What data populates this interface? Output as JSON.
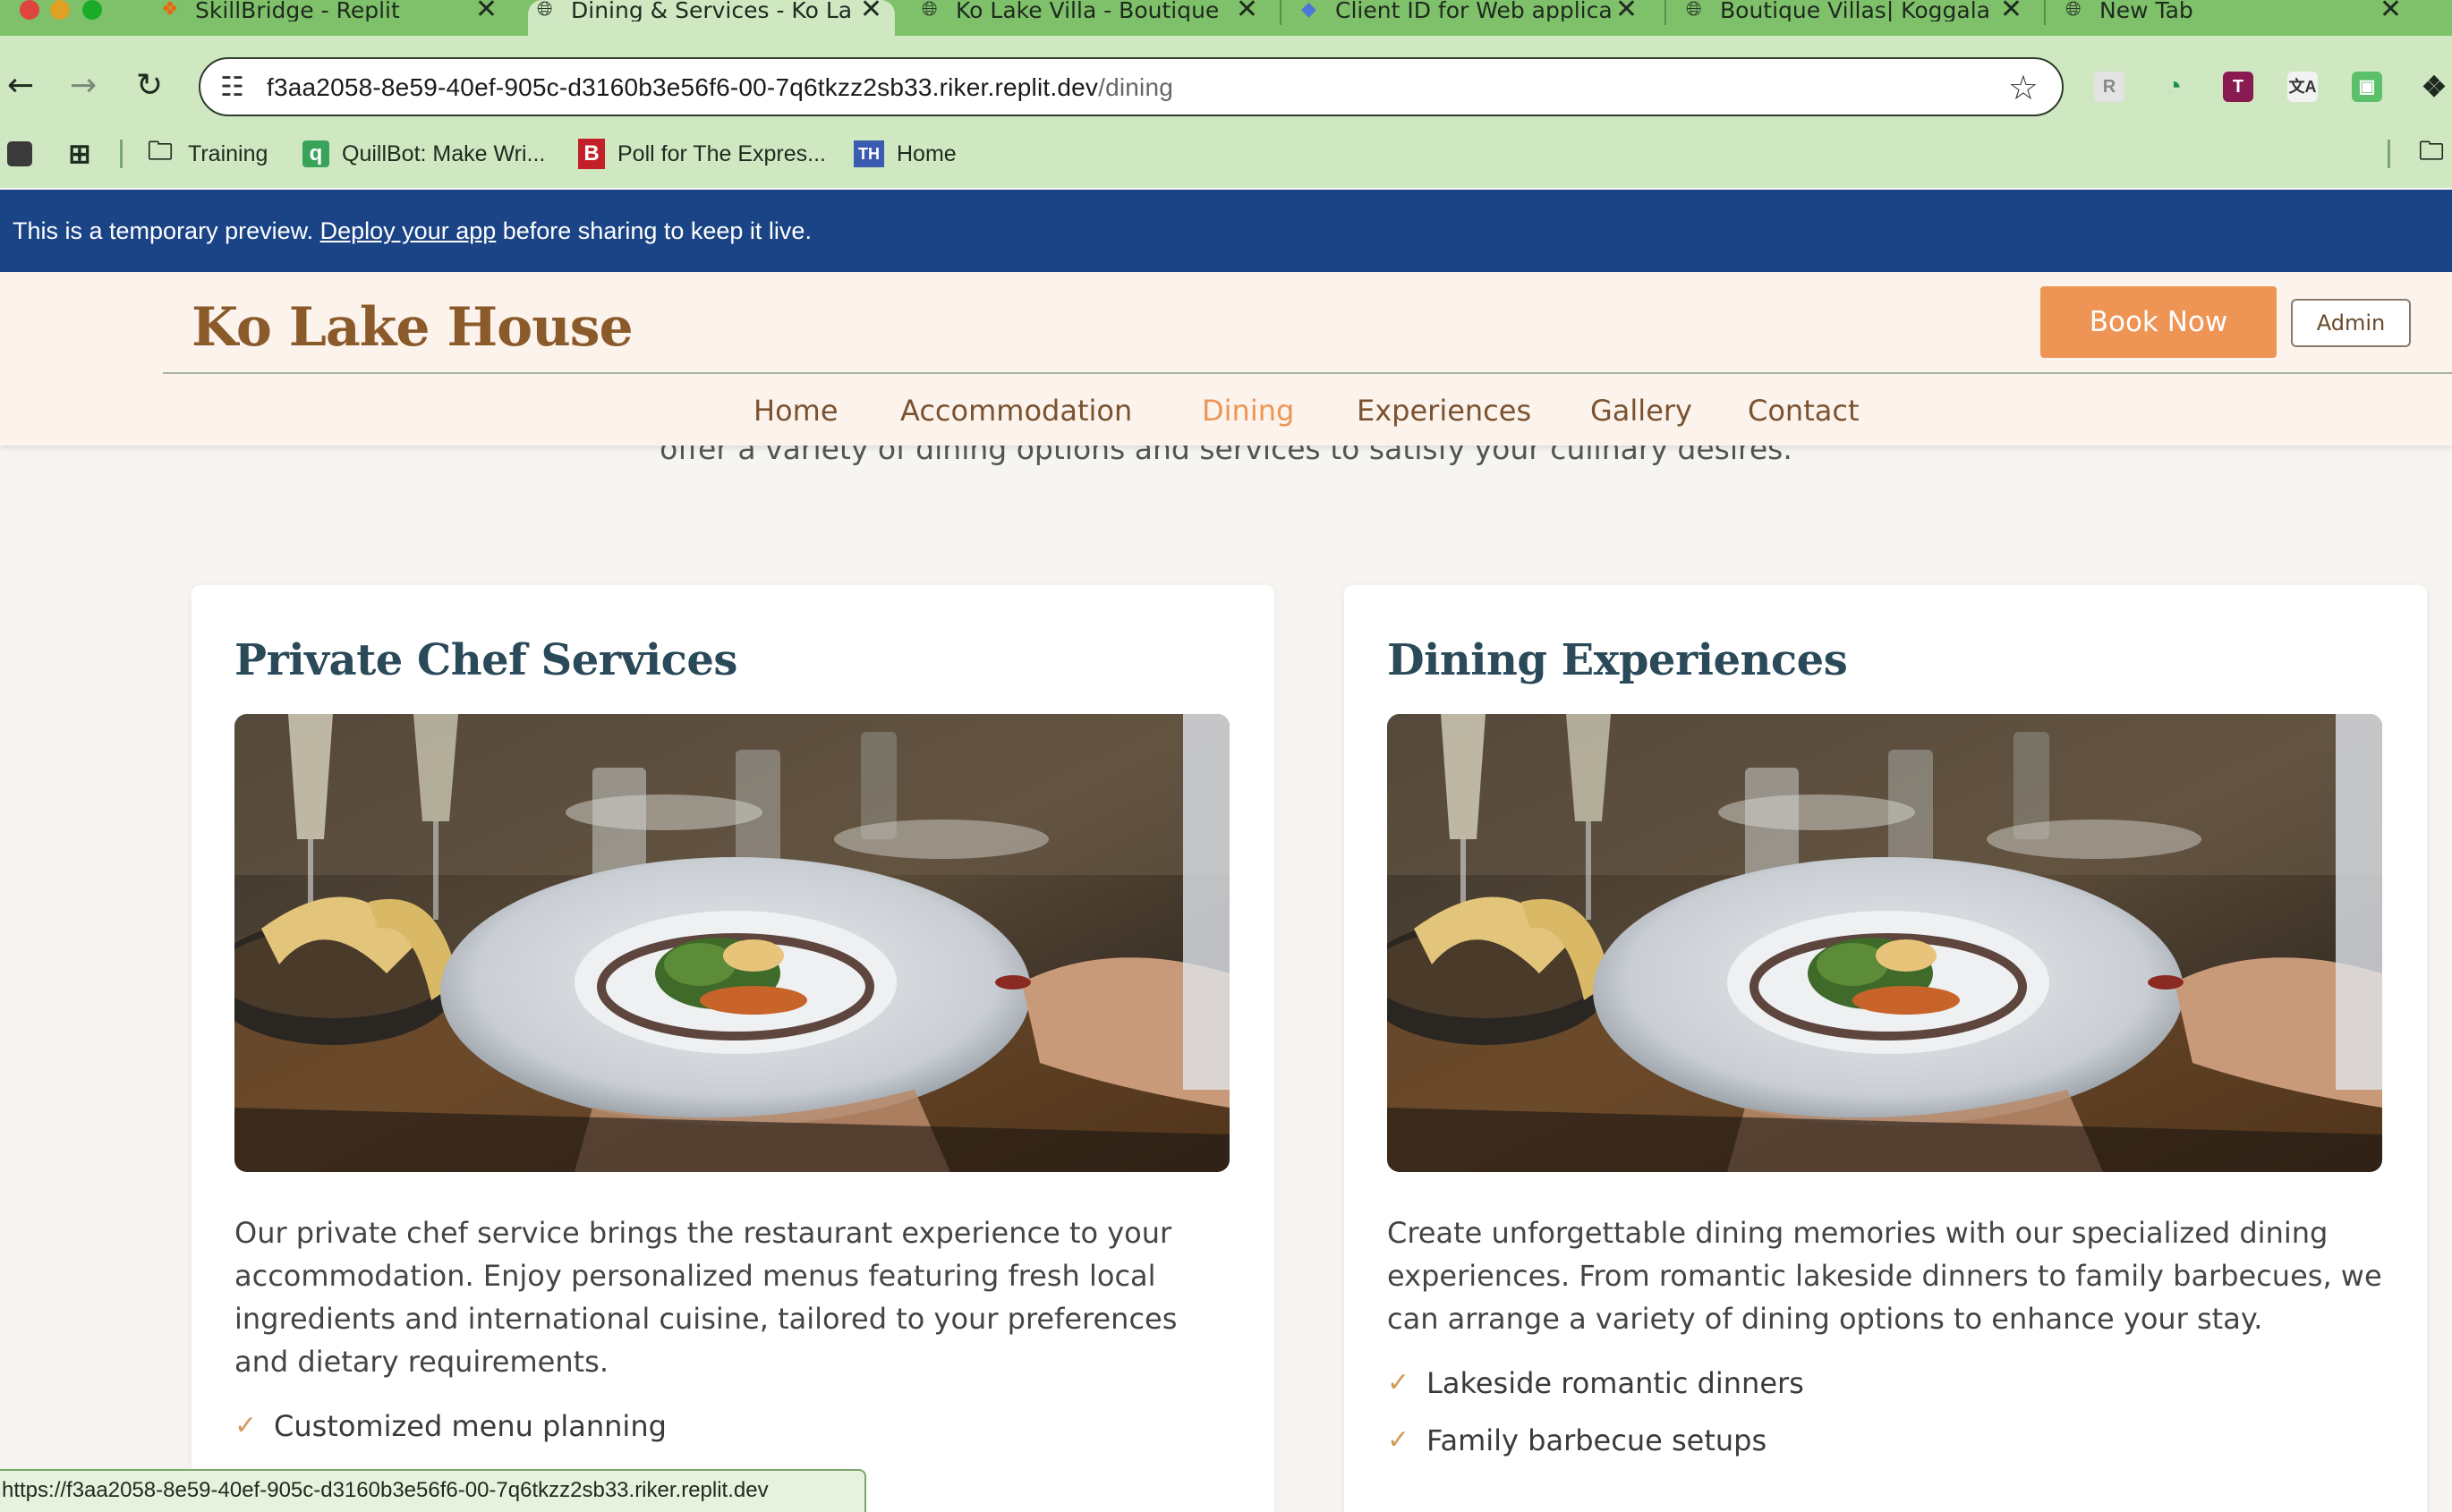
{
  "browser": {
    "tabs": [
      {
        "title": "SkillBridge - Replit",
        "icon": "replit-icon"
      },
      {
        "title": "Dining & Services - Ko La",
        "icon": "globe-icon"
      },
      {
        "title": "Ko Lake Villa - Boutique",
        "icon": "globe-icon"
      },
      {
        "title": "Client ID for Web applica",
        "icon": "google-cloud-icon"
      },
      {
        "title": "Boutique Villas| Koggala",
        "icon": "globe-icon"
      },
      {
        "title": "New Tab",
        "icon": "globe-icon"
      }
    ],
    "address": {
      "host": "f3aa2058-8e59-40ef-905c-d3160b3e56f6-00-7q6tkzz2sb33.riker.replit.dev",
      "path": "/dining"
    },
    "bookmarks": [
      {
        "label": "Training",
        "icon": "folder-icon"
      },
      {
        "label": "QuillBot: Make Wri...",
        "icon": "quillbot-icon"
      },
      {
        "label": "Poll for The Expres...",
        "icon": "poll-icon"
      },
      {
        "label": "Home",
        "icon": "th-icon"
      }
    ],
    "status_url": "https://f3aa2058-8e59-40ef-905c-d3160b3e56f6-00-7q6tkzz2sb33.riker.replit.dev"
  },
  "banner": {
    "before": "This is a temporary preview. ",
    "link": "Deploy your app",
    "after": " before sharing to keep it live."
  },
  "site": {
    "brand": "Ko Lake House",
    "book_label": "Book Now",
    "admin_label": "Admin",
    "nav": [
      "Home",
      "Accommodation",
      "Dining",
      "Experiences",
      "Gallery",
      "Contact"
    ],
    "active_nav": "Dining",
    "intro_tail": "offer a variety of dining options and services to satisfy your culinary desires."
  },
  "cards": [
    {
      "title": "Private Chef Services",
      "description": "Our private chef service brings the restaurant experience to your accommodation. Enjoy personalized menus featuring fresh local ingredients and international cuisine, tailored to your preferences and dietary requirements.",
      "features": [
        "Customized menu planning"
      ]
    },
    {
      "title": "Dining Experiences",
      "description": "Create unforgettable dining memories with our specialized dining experiences. From romantic lakeside dinners to family barbecues, we can arrange a variety of dining options to enhance your stay.",
      "features": [
        "Lakeside romantic dinners",
        "Family barbecue setups"
      ]
    }
  ],
  "colors": {
    "accent": "#ee9555",
    "brand_brown": "#8b5a2b",
    "heading_blue": "#2a4a5a",
    "banner_blue": "#1b4486",
    "chrome_green": "#7fc06a"
  }
}
